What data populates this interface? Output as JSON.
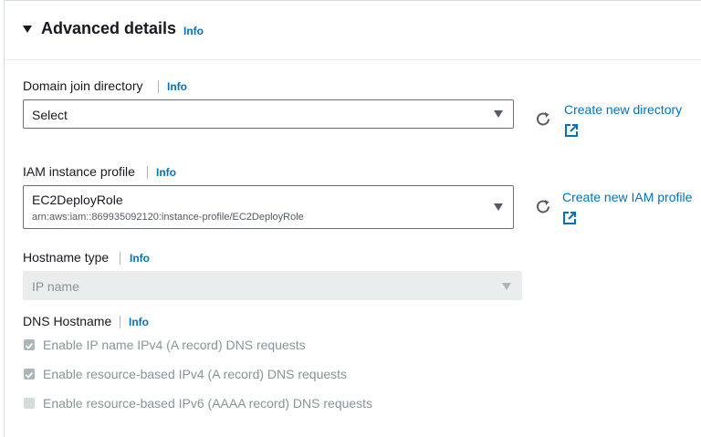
{
  "section": {
    "title": "Advanced details",
    "info": "Info"
  },
  "domain_join": {
    "label": "Domain join directory",
    "info": "Info",
    "value": "Select",
    "link": "Create new directory"
  },
  "iam_profile": {
    "label": "IAM instance profile",
    "info": "Info",
    "value": "EC2DeployRole",
    "sub": "arn:aws:iam::869935092120:instance-profile/EC2DeployRole",
    "link": "Create new IAM profile"
  },
  "hostname_type": {
    "label": "Hostname type",
    "info": "Info",
    "value": "IP name"
  },
  "dns_hostname": {
    "label": "DNS Hostname",
    "info": "Info",
    "options": [
      {
        "label": "Enable IP name IPv4 (A record) DNS requests",
        "checked": true
      },
      {
        "label": "Enable resource-based IPv4 (A record) DNS requests",
        "checked": true
      },
      {
        "label": "Enable resource-based IPv6 (AAAA record) DNS requests",
        "checked": false
      }
    ]
  },
  "colors": {
    "link": "#0073bb",
    "text": "#16191f",
    "disabled_bg": "#eaeded",
    "disabled_text": "#879596"
  }
}
